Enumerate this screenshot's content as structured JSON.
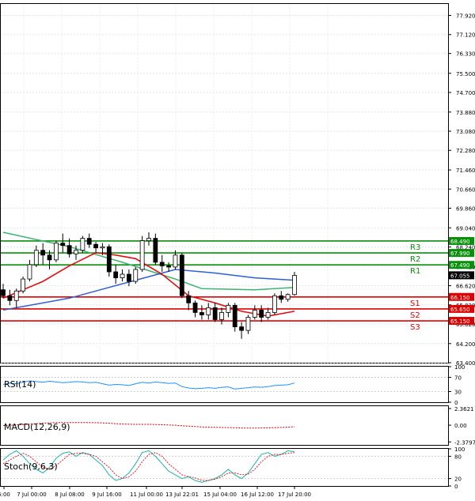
{
  "chart_data": {
    "type": "candlestick",
    "title": "",
    "main": {
      "ylim": [
        63.4,
        78.4
      ],
      "y_ticks": [
        "77.920",
        "77.120",
        "76.330",
        "75.500",
        "74.700",
        "73.880",
        "73.080",
        "72.280",
        "71.460",
        "70.660",
        "69.860",
        "69.040",
        "68.240",
        "67.420",
        "66.620",
        "65.820",
        "65.020",
        "64.200",
        "63.400"
      ],
      "candles": [
        [
          66.45,
          66.7,
          66.1,
          66.2
        ],
        [
          66.2,
          66.45,
          65.8,
          66.0
        ],
        [
          66.0,
          66.5,
          65.7,
          66.4
        ],
        [
          66.4,
          67.0,
          66.3,
          66.9
        ],
        [
          66.9,
          67.7,
          66.8,
          67.5
        ],
        [
          67.5,
          68.3,
          67.4,
          68.1
        ],
        [
          68.1,
          68.4,
          67.5,
          67.9
        ],
        [
          67.9,
          68.1,
          67.3,
          67.7
        ],
        [
          67.7,
          68.5,
          67.6,
          68.4
        ],
        [
          68.4,
          68.8,
          68.0,
          68.3
        ],
        [
          68.3,
          68.6,
          67.8,
          67.95
        ],
        [
          67.95,
          68.3,
          67.7,
          68.1
        ],
        [
          68.1,
          68.7,
          68.0,
          68.6
        ],
        [
          68.6,
          68.8,
          68.2,
          68.35
        ],
        [
          68.35,
          68.45,
          68.0,
          68.2
        ],
        [
          68.2,
          68.4,
          67.9,
          68.25
        ],
        [
          68.25,
          68.35,
          67.0,
          67.2
        ],
        [
          67.2,
          67.5,
          66.7,
          66.95
        ],
        [
          66.95,
          67.3,
          66.8,
          67.1
        ],
        [
          67.1,
          67.3,
          66.6,
          66.8
        ],
        [
          66.8,
          67.4,
          66.7,
          67.3
        ],
        [
          67.3,
          68.7,
          67.2,
          68.5
        ],
        [
          68.5,
          68.85,
          68.3,
          68.6
        ],
        [
          68.6,
          68.8,
          67.5,
          67.6
        ],
        [
          67.6,
          67.9,
          67.2,
          67.45
        ],
        [
          67.45,
          67.6,
          67.2,
          67.4
        ],
        [
          67.4,
          68.1,
          67.3,
          67.9
        ],
        [
          67.9,
          68.0,
          66.1,
          66.2
        ],
        [
          66.2,
          66.4,
          65.6,
          65.9
        ],
        [
          65.9,
          66.0,
          65.3,
          65.5
        ],
        [
          65.5,
          65.8,
          65.2,
          65.4
        ],
        [
          65.4,
          65.9,
          65.2,
          65.7
        ],
        [
          65.7,
          65.9,
          65.1,
          65.2
        ],
        [
          65.2,
          65.7,
          65.0,
          65.5
        ],
        [
          65.5,
          65.9,
          65.3,
          65.8
        ],
        [
          65.8,
          65.9,
          64.7,
          64.9
        ],
        [
          64.9,
          65.1,
          64.4,
          64.75
        ],
        [
          64.75,
          65.4,
          64.6,
          65.3
        ],
        [
          65.3,
          65.8,
          65.2,
          65.6
        ],
        [
          65.6,
          65.8,
          65.1,
          65.3
        ],
        [
          65.3,
          65.7,
          65.2,
          65.5
        ],
        [
          65.5,
          66.3,
          65.4,
          66.2
        ],
        [
          66.2,
          66.4,
          65.9,
          66.05
        ],
        [
          66.05,
          66.3,
          65.95,
          66.25
        ],
        [
          66.25,
          67.2,
          66.2,
          67.05
        ]
      ],
      "ma_blue": [
        [
          0,
          65.6
        ],
        [
          10,
          66.1
        ],
        [
          20,
          66.85
        ],
        [
          26,
          67.3
        ],
        [
          32,
          67.15
        ],
        [
          38,
          66.95
        ],
        [
          44,
          66.85
        ]
      ],
      "ma_green": [
        [
          0,
          68.85
        ],
        [
          10,
          68.25
        ],
        [
          18,
          67.6
        ],
        [
          26,
          66.9
        ],
        [
          30,
          66.5
        ],
        [
          38,
          66.45
        ],
        [
          44,
          66.55
        ]
      ],
      "ma_red": [
        [
          0,
          66.1
        ],
        [
          6,
          66.8
        ],
        [
          10,
          67.45
        ],
        [
          14,
          68.0
        ],
        [
          17,
          67.9
        ],
        [
          20,
          67.75
        ],
        [
          24,
          67.1
        ],
        [
          28,
          66.2
        ],
        [
          32,
          65.9
        ],
        [
          36,
          65.55
        ],
        [
          40,
          65.35
        ],
        [
          44,
          65.55
        ]
      ],
      "levels": [
        {
          "price": 68.49,
          "label": "R3",
          "value": "68.490",
          "color": "#0a8f0a"
        },
        {
          "price": 67.99,
          "label": "R2",
          "value": "67.990",
          "color": "#0a8f0a"
        },
        {
          "price": 67.49,
          "label": "R1",
          "value": "67.490",
          "color": "#0a8f0a"
        },
        {
          "price": 66.15,
          "label": "S1",
          "value": "66.150",
          "color": "#e00000"
        },
        {
          "price": 65.65,
          "label": "S2",
          "value": "65.650",
          "color": "#e00000"
        },
        {
          "price": 65.15,
          "label": "S3",
          "value": "65.150",
          "color": "#e00000"
        }
      ],
      "current": {
        "price": 67.055,
        "value": "67.055"
      }
    },
    "x_ticks": [
      "6:00",
      "7 Jul 00:00",
      "8 Jul 08:00",
      "9 Jul 16:00",
      "11 Jul 00:00",
      "13 Jul 22:01",
      "15 Jul 04:00",
      "16 Jul 12:00",
      "17 Jul 20:00"
    ],
    "rsi": {
      "label": "RSI(14)",
      "ylim": [
        0,
        100
      ],
      "y_ticks": [
        "100",
        "70",
        "30",
        "0"
      ],
      "values": [
        50,
        54,
        52,
        57,
        60,
        58,
        56,
        59,
        57,
        55,
        56,
        58,
        57,
        55,
        56,
        52,
        48,
        50,
        49,
        47,
        52,
        56,
        54,
        57,
        55,
        53,
        54,
        44,
        40,
        38,
        39,
        41,
        39,
        42,
        43,
        37,
        39,
        41,
        43,
        42,
        44,
        47,
        48,
        49,
        54
      ]
    },
    "macd": {
      "label": "MACD(12,26,9)",
      "ylim": [
        -2.8,
        2.7
      ],
      "y_ticks": [
        "2.3621",
        "0.00",
        "-2.3797"
      ],
      "values": [
        -0.05,
        0.0,
        0.05,
        0.1,
        0.15,
        0.22,
        0.28,
        0.32,
        0.36,
        0.38,
        0.38,
        0.37,
        0.38,
        0.37,
        0.35,
        0.32,
        0.27,
        0.22,
        0.18,
        0.14,
        0.12,
        0.12,
        0.12,
        0.1,
        0.06,
        0.03,
        0.0,
        -0.08,
        -0.14,
        -0.2,
        -0.25,
        -0.28,
        -0.3,
        -0.32,
        -0.34,
        -0.38,
        -0.4,
        -0.42,
        -0.42,
        -0.4,
        -0.38,
        -0.35,
        -0.32,
        -0.28,
        -0.22
      ]
    },
    "stoch": {
      "label": "Stoch(9,6,3)",
      "ylim": [
        0,
        100
      ],
      "y_ticks": [
        "100",
        "80",
        "20",
        "0"
      ],
      "k": [
        70,
        85,
        95,
        80,
        60,
        45,
        35,
        50,
        75,
        88,
        92,
        80,
        90,
        85,
        70,
        55,
        30,
        15,
        20,
        35,
        60,
        90,
        95,
        80,
        60,
        40,
        30,
        20,
        25,
        15,
        10,
        15,
        20,
        30,
        45,
        30,
        20,
        35,
        60,
        85,
        90,
        80,
        85,
        95,
        92
      ],
      "d": [
        60,
        70,
        80,
        88,
        80,
        65,
        50,
        45,
        55,
        70,
        85,
        88,
        88,
        85,
        80,
        65,
        50,
        30,
        20,
        25,
        40,
        65,
        85,
        90,
        80,
        60,
        45,
        30,
        25,
        22,
        15,
        15,
        18,
        25,
        35,
        35,
        30,
        32,
        45,
        65,
        80,
        85,
        85,
        88,
        90
      ]
    }
  }
}
